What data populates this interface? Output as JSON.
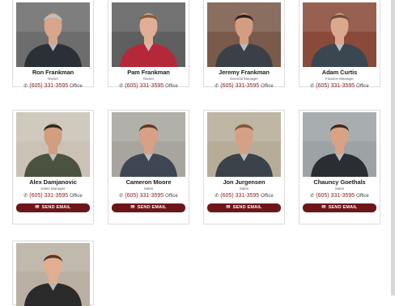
{
  "staff": [
    {
      "name": "Ron Frankman",
      "title": "Owner",
      "phone": "(605) 331-3595",
      "phone_type": "Office",
      "bg": "#6d6d6d",
      "shirt": "#2b2f36",
      "skin": "#d9a58a",
      "hair": "#bfbfbf"
    },
    {
      "name": "Pam Frankman",
      "title": "Owner",
      "phone": "(605) 331-3595",
      "phone_type": "Office",
      "bg": "#5f5f5f",
      "shirt": "#b5283a",
      "skin": "#e0ae95",
      "hair": "#8a5a3a"
    },
    {
      "name": "Jeremy Frankman",
      "title": "General Manager",
      "phone": "(605) 331-3595",
      "phone_type": "Office",
      "bg": "#7a5a4a",
      "shirt": "#3b4048",
      "skin": "#d49c80",
      "hair": "#2a2220"
    },
    {
      "name": "Adam Curtis",
      "title": "Finance Manager",
      "phone": "(605) 331-3595",
      "phone_type": "Office",
      "bg": "#8a4a3a",
      "shirt": "#3a4650",
      "skin": "#dca88c",
      "hair": "#6b4e3a"
    },
    {
      "name": "Alex Damjanovic",
      "title": "Sales Manager",
      "phone": "(605) 331-3595",
      "phone_type": "Office",
      "bg": "#c9c2b5",
      "shirt": "#4b5340",
      "skin": "#d39d80",
      "hair": "#2e2822",
      "email_label": "SEND EMAIL"
    },
    {
      "name": "Cameron Moore",
      "title": "Sales",
      "phone": "(605) 331-3595",
      "phone_type": "Office",
      "bg": "#a7a59e",
      "shirt": "#3d4652",
      "skin": "#d8a084",
      "hair": "#5a3b28",
      "email_label": "SEND EMAIL"
    },
    {
      "name": "Jon Jurgensen",
      "title": "Sales",
      "phone": "(605) 331-3595",
      "phone_type": "Office",
      "bg": "#b7ac98",
      "shirt": "#3a424a",
      "skin": "#d6a084",
      "hair": "#7a5a3e",
      "email_label": "SEND EMAIL"
    },
    {
      "name": "Chauncy Goethals",
      "title": "Sales",
      "phone": "(605) 331-3595",
      "phone_type": "Office",
      "bg": "#9da3a5",
      "shirt": "#2a2e33",
      "skin": "#d8a285",
      "hair": "#3a2a22",
      "email_label": "SEND EMAIL"
    },
    {
      "name": "",
      "title": "",
      "phone": "",
      "phone_type": "",
      "bg": "#b9b0a3",
      "shirt": "#2a2a2a",
      "skin": "#e2ae92",
      "hair": "#5a3420"
    }
  ],
  "colors": {
    "accent": "#8b1a1a",
    "button": "#6d1619"
  },
  "icons": {
    "phone": "phone-icon",
    "email": "envelope-icon"
  }
}
